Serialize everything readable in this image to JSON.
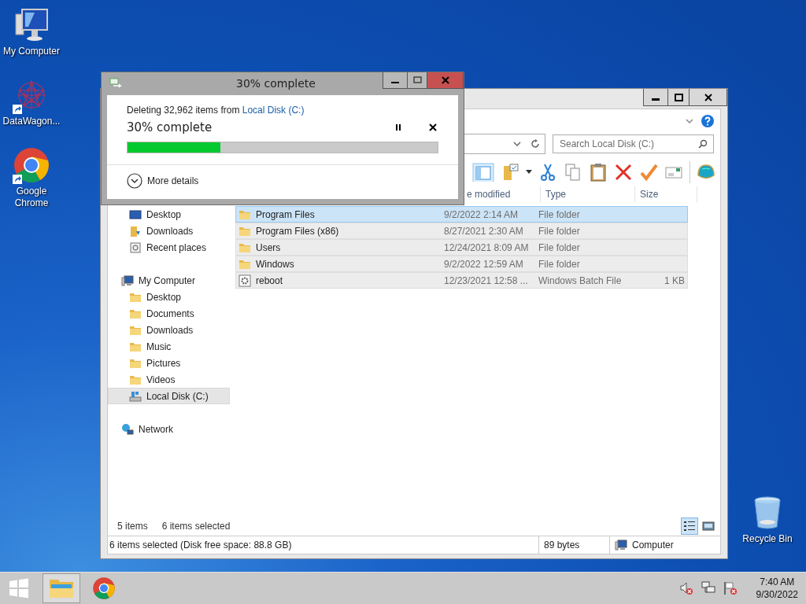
{
  "desktop_icons": [
    {
      "label": "My Computer",
      "kind": "computer",
      "shortcut": false
    },
    {
      "label": "DataWagon...",
      "kind": "app",
      "shortcut": true
    },
    {
      "label": "Google Chrome",
      "kind": "chrome",
      "shortcut": true
    },
    {
      "label": "Recycle Bin",
      "kind": "recycle",
      "shortcut": false
    }
  ],
  "explorer": {
    "search": {
      "placeholder": "Search Local Disk (C:)"
    },
    "columns": [
      {
        "label": "e modified",
        "kind": "date"
      },
      {
        "label": "Type",
        "kind": "type"
      },
      {
        "label": "Size",
        "kind": "size"
      }
    ],
    "nav": {
      "favorites": [
        {
          "label": "Desktop",
          "kind": "desktop",
          "selected": false
        },
        {
          "label": "Downloads",
          "kind": "downloads",
          "selected": false
        },
        {
          "label": "Recent places",
          "kind": "recent",
          "selected": false
        }
      ],
      "tree": [
        {
          "label": "My Computer",
          "kind": "computer",
          "selected": false,
          "children": [
            {
              "label": "Desktop",
              "kind": "folder",
              "selected": false
            },
            {
              "label": "Documents",
              "kind": "folder",
              "selected": false
            },
            {
              "label": "Downloads",
              "kind": "folder",
              "selected": false
            },
            {
              "label": "Music",
              "kind": "folder",
              "selected": false
            },
            {
              "label": "Pictures",
              "kind": "folder",
              "selected": false
            },
            {
              "label": "Videos",
              "kind": "folder",
              "selected": false
            },
            {
              "label": "Local Disk (C:)",
              "kind": "drive",
              "selected": true
            }
          ]
        },
        {
          "label": "Network",
          "kind": "network",
          "selected": false
        }
      ]
    },
    "files": [
      {
        "name": "Program Files",
        "modified": "9/2/2022 2:14 AM",
        "type": "File folder",
        "kind": "folder",
        "selected": true,
        "focused": true
      },
      {
        "name": "Program Files (x86)",
        "modified": "8/27/2021 2:30 AM",
        "type": "File folder",
        "kind": "folder",
        "selected": true,
        "focused": false
      },
      {
        "name": "Users",
        "modified": "12/24/2021 8:09 AM",
        "type": "File folder",
        "kind": "folder",
        "selected": true,
        "focused": false
      },
      {
        "name": "Windows",
        "modified": "9/2/2022 12:59 AM",
        "type": "File folder",
        "kind": "folder",
        "selected": true,
        "focused": false
      },
      {
        "name": "reboot",
        "modified": "12/23/2021 12:58 ...",
        "type": "Windows Batch File",
        "size": "1 KB",
        "kind": "batch",
        "selected": true,
        "focused": false
      }
    ],
    "details": {
      "count": "5 items",
      "selection": "6 items selected"
    },
    "view_buttons": [
      {
        "kind": "details",
        "selected": true
      },
      {
        "kind": "preview",
        "selected": false
      }
    ],
    "status_bar": {
      "selection": "6 items selected (Disk free space: 88.8 GB)",
      "size": "89 bytes",
      "location": "Computer"
    }
  },
  "dialog": {
    "title": "30% complete",
    "message": "Deleting 32,962 items from ",
    "source": "Local Disk (C:)",
    "heading": "30% complete",
    "level": 0.3,
    "more": "More details"
  },
  "taskbar": {
    "apps": [
      {
        "kind": "explorer",
        "active": true
      },
      {
        "kind": "chrome",
        "active": false
      }
    ],
    "tray": [
      {
        "kind": "sound"
      },
      {
        "kind": "network"
      },
      {
        "kind": "flag"
      }
    ],
    "clock": {
      "time": "7:40 AM",
      "date": "9/30/2022"
    }
  }
}
